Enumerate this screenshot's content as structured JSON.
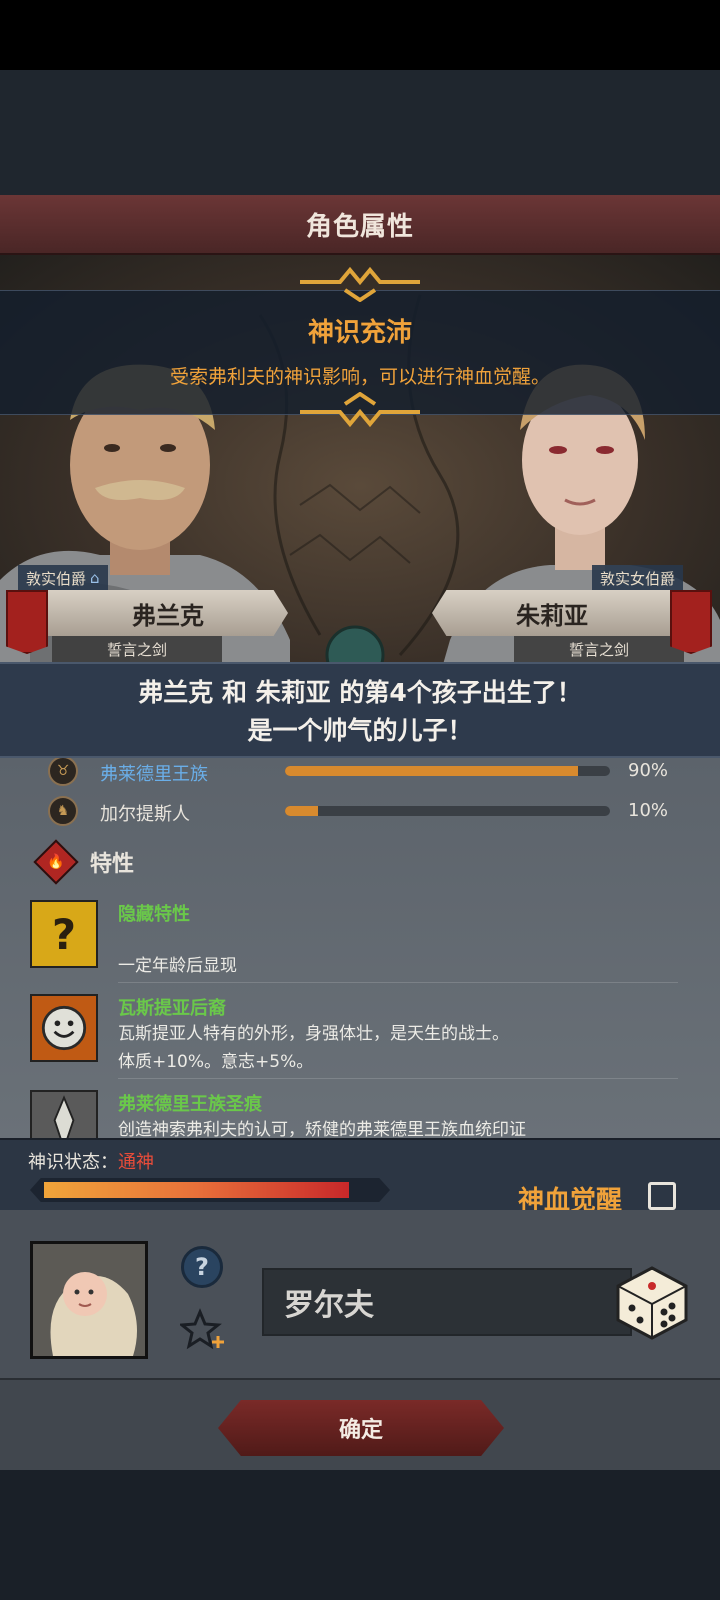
{
  "window": {
    "title": "角色属性"
  },
  "banner": {
    "title": "神识充沛",
    "text": "受索弗利夫的神识影响，可以进行神血觉醒。"
  },
  "parents": {
    "father": {
      "rank": "敦实伯爵",
      "name": "弗兰克",
      "title": "誓言之剑"
    },
    "mother": {
      "rank": "敦实女伯爵",
      "name": "朱莉亚",
      "title": "誓言之剑"
    }
  },
  "birth": {
    "line1": "弗兰克 和 朱莉亚 的第4个孩子出生了！",
    "line2": "是一个帅气的儿子！"
  },
  "races": [
    {
      "name": "弗莱德里王族",
      "percent_label": "90%",
      "fill": 0.9,
      "name_color": "#6aaee8"
    },
    {
      "name": "加尔提斯人",
      "percent_label": "10%",
      "fill": 0.1,
      "name_color": "#e8e4dc"
    }
  ],
  "traits_header": {
    "label": "特性",
    "icon": "fire-icon"
  },
  "traits": [
    {
      "name": "隐藏特性",
      "desc1": "",
      "desc2": "一定年龄后显现",
      "icon": "question-mark-icon"
    },
    {
      "name": "瓦斯提亚后裔",
      "desc1": "瓦斯提亚人特有的外形，身强体壮，是天生的战士。",
      "desc2": "体质+10%。意志+5%。",
      "icon": "smiley-sun-icon"
    },
    {
      "name": "弗莱德里王族圣痕",
      "desc1": "创造神索弗利夫的认可，矫健的弗莱德里王族血统印证",
      "desc2": "",
      "icon": "crest-icon"
    }
  ],
  "divine": {
    "label": "神识状态：",
    "value": "通神",
    "fill": 0.92,
    "awaken_label": "神血觉醒",
    "awaken_checked": false
  },
  "naming": {
    "name_value": "罗尔夫",
    "help_icon": "question-icon",
    "favorite_icon": "star-plus-icon",
    "random_icon": "dice-icon"
  },
  "confirm_label": "确定",
  "colors": {
    "accent_orange": "#f0a23a",
    "trait_green": "#6ac84a",
    "status_red": "#e84c3a",
    "title_bar": "#6b3636"
  }
}
